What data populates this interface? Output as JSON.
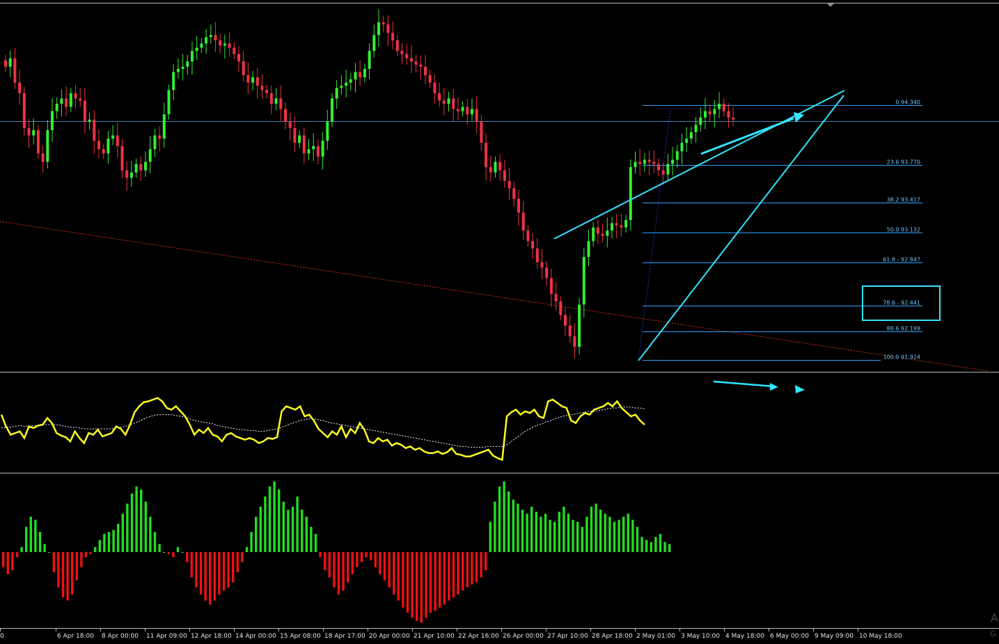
{
  "colors": {
    "background": "#000000",
    "bull": "#33ee33",
    "bear": "#ee3344",
    "fib": "#2ea3ff",
    "trend": "#33e5ff",
    "oscillator": "#ffff22",
    "signal": "#ffffff",
    "hist_pos": "#22dd22",
    "hist_neg": "#ee1111",
    "diagonal": "#cc3311",
    "separator": "#bbbbbb"
  },
  "chart_data": {
    "type": "candlestick",
    "x_ticks": [
      "0",
      "6 Apr 18:00",
      "8 Apr 00:00",
      "11 Apr 09:00",
      "12 Apr 18:00",
      "14 Apr 00:00",
      "15 Apr 08:00",
      "18 Apr 17:00",
      "20 Apr 00:00",
      "21 Apr 10:00",
      "22 Apr 16:00",
      "26 Apr 00:00",
      "27 Apr 10:00",
      "28 Apr 18:00",
      "2 May 01:00",
      "3 May 10:00",
      "4 May 18:00",
      "6 May 00:00",
      "9 May 09:00",
      "10 May 18:00"
    ],
    "fib_levels": [
      {
        "label": "0 94.340",
        "value": 94.34
      },
      {
        "label": "23.6 93.770",
        "value": 93.77
      },
      {
        "label": "38.2 93.417",
        "value": 93.417
      },
      {
        "label": "50.0 93.132",
        "value": 93.132
      },
      {
        "label": "61.8 - 92.847",
        "value": 92.847
      },
      {
        "label": "78.6 - 92.441",
        "value": 92.441
      },
      {
        "label": "88.6 92.199",
        "value": 92.199
      },
      {
        "label": "100.0 91.924",
        "value": 91.924
      }
    ],
    "highlighted_level": "78.6 - 92.441",
    "price_closes": [
      94.7,
      94.78,
      94.55,
      94.45,
      94.12,
      94.05,
      94.1,
      93.88,
      93.8,
      94.1,
      94.28,
      94.35,
      94.4,
      94.32,
      94.45,
      94.4,
      94.38,
      94.18,
      94.2,
      94.0,
      93.92,
      93.88,
      94.02,
      94.05,
      93.95,
      93.72,
      93.65,
      93.7,
      93.78,
      93.72,
      93.8,
      93.92,
      94.05,
      94.02,
      94.25,
      94.48,
      94.65,
      94.68,
      94.7,
      94.75,
      94.85,
      94.88,
      94.92,
      94.98,
      95.0,
      94.95,
      94.9,
      94.92,
      94.88,
      94.82,
      94.75,
      94.62,
      94.55,
      94.6,
      94.52,
      94.48,
      94.45,
      94.35,
      94.4,
      94.3,
      94.18,
      94.12,
      93.98,
      94.05,
      93.88,
      93.92,
      93.95,
      93.85,
      94.0,
      94.18,
      94.4,
      94.5,
      94.52,
      94.55,
      94.58,
      94.65,
      94.6,
      94.68,
      94.85,
      95.0,
      95.12,
      95.1,
      95.02,
      94.95,
      94.85,
      94.82,
      94.78,
      94.75,
      94.72,
      94.7,
      94.62,
      94.55,
      94.45,
      94.38,
      94.35,
      94.4,
      94.3,
      94.28,
      94.32,
      94.25,
      94.3,
      94.18,
      93.98,
      93.75,
      93.7,
      93.8,
      93.72,
      93.62,
      93.55,
      93.45,
      93.32,
      93.15,
      93.05,
      92.98,
      92.85,
      92.8,
      92.7,
      92.55,
      92.48,
      92.35,
      92.25,
      92.15,
      92.05,
      92.45,
      92.9,
      93.05,
      93.18,
      93.12,
      93.1,
      93.15,
      93.22,
      93.2,
      93.18,
      93.25,
      93.75,
      93.8,
      93.78,
      93.82,
      93.8,
      93.78,
      93.72,
      93.68,
      93.78,
      93.82,
      93.9,
      93.98,
      94.02,
      94.08,
      94.15,
      94.22,
      94.28,
      94.25,
      94.3,
      94.35,
      94.28,
      94.22,
      94.2
    ],
    "oscillator": [
      62,
      48,
      38,
      40,
      42,
      34,
      48,
      46,
      49,
      50,
      58,
      52,
      40,
      37,
      35,
      30,
      42,
      34,
      28,
      40,
      38,
      44,
      36,
      38,
      40,
      48,
      45,
      38,
      50,
      65,
      72,
      77,
      78,
      80,
      82,
      78,
      70,
      68,
      72,
      66,
      60,
      50,
      38,
      44,
      40,
      46,
      38,
      36,
      30,
      38,
      40,
      36,
      34,
      32,
      34,
      32,
      28,
      30,
      34,
      33,
      35,
      66,
      72,
      70,
      68,
      72,
      60,
      62,
      55,
      45,
      40,
      35,
      42,
      38,
      48,
      35,
      45,
      40,
      52,
      44,
      30,
      28,
      34,
      30,
      32,
      25,
      28,
      26,
      22,
      24,
      20,
      22,
      18,
      16,
      16,
      18,
      15,
      17,
      22,
      15,
      14,
      12,
      12,
      14,
      16,
      18,
      20,
      13,
      10,
      8,
      60,
      65,
      68,
      62,
      66,
      64,
      68,
      60,
      58,
      78,
      80,
      76,
      72,
      70,
      55,
      52,
      60,
      64,
      62,
      68,
      70,
      72,
      76,
      72,
      78,
      70,
      65,
      60,
      62,
      55,
      50
    ],
    "signal_line": [
      46,
      47,
      47,
      48,
      49,
      48,
      48,
      49,
      49,
      50,
      50,
      50,
      50,
      49,
      48,
      47,
      47,
      46,
      45,
      45,
      45,
      45,
      45,
      45,
      45,
      46,
      47,
      48,
      50,
      52,
      54,
      57,
      59,
      61,
      62,
      62,
      62,
      62,
      61,
      60,
      59,
      57,
      55,
      54,
      53,
      52,
      51,
      49,
      48,
      47,
      46,
      45,
      44,
      44,
      43,
      43,
      42,
      42,
      43,
      44,
      45,
      47,
      49,
      51,
      53,
      55,
      56,
      57,
      57,
      56,
      55,
      53,
      52,
      51,
      50,
      49,
      48,
      47,
      46,
      45,
      44,
      43,
      42,
      41,
      40,
      39,
      38,
      37,
      36,
      35,
      34,
      33,
      32,
      31,
      30,
      29,
      28,
      27,
      26,
      25,
      24,
      24,
      23,
      23,
      23,
      23,
      24,
      24,
      24,
      24,
      26,
      30,
      34,
      38,
      42,
      45,
      48,
      50,
      52,
      54,
      56,
      58,
      60,
      61,
      62,
      63,
      64,
      65,
      66,
      66,
      67,
      68,
      69,
      70,
      70,
      71,
      71,
      71,
      70,
      70,
      69
    ],
    "histogram": [
      -15,
      -22,
      -18,
      -5,
      5,
      25,
      35,
      32,
      20,
      8,
      0,
      -20,
      -35,
      -45,
      -48,
      -42,
      -28,
      -15,
      -5,
      -2,
      5,
      12,
      18,
      20,
      22,
      28,
      38,
      48,
      58,
      65,
      62,
      50,
      35,
      20,
      8,
      0,
      -2,
      -5,
      5,
      0,
      -10,
      -25,
      -35,
      -42,
      -48,
      -52,
      -48,
      -42,
      -38,
      -35,
      -30,
      -20,
      -10,
      5,
      20,
      35,
      45,
      55,
      65,
      70,
      62,
      50,
      42,
      45,
      55,
      42,
      35,
      25,
      18,
      -5,
      -18,
      -25,
      -35,
      -42,
      -38,
      -30,
      -22,
      -15,
      -10,
      -5,
      -8,
      -15,
      -22,
      -28,
      -35,
      -42,
      -48,
      -55,
      -60,
      -65,
      -68,
      -70,
      -65,
      -60,
      -58,
      -55,
      -52,
      -48,
      -45,
      -42,
      -38,
      -35,
      -32,
      -30,
      -25,
      -18,
      30,
      50,
      65,
      70,
      60,
      52,
      48,
      42,
      38,
      45,
      40,
      35,
      38,
      32,
      30,
      40,
      45,
      38,
      32,
      30,
      25,
      35,
      45,
      48,
      42,
      38,
      35,
      30,
      32,
      35,
      38,
      32,
      25,
      15,
      12,
      10,
      15,
      18,
      10,
      8
    ],
    "x_tick_count": 20
  }
}
